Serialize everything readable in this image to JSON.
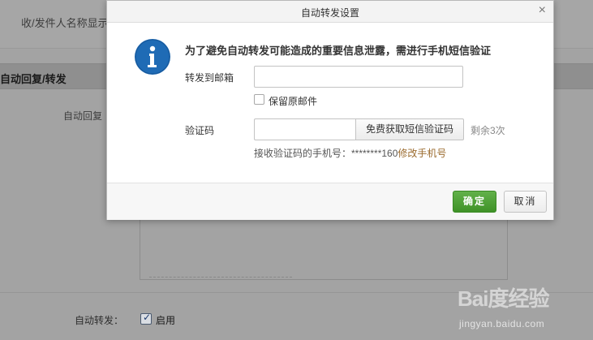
{
  "background": {
    "sender_name_label": "收/发件人名称显示",
    "section_title": "自动回复/转发",
    "auto_reply_label": "自动回复",
    "auto_forward_label": "自动转发：",
    "auto_forward_checkbox_label": "启用",
    "auto_forward_checked": true
  },
  "dialog": {
    "title": "自动转发设置",
    "close_glyph": "×",
    "warning": "为了避免自动转发可能造成的重要信息泄露，需进行手机短信验证",
    "forward_email_label": "转发到邮箱",
    "forward_email_value": "",
    "keep_original_label": "保留原邮件",
    "keep_original_checked": false,
    "code_label": "验证码",
    "code_value": "",
    "get_code_button": "免费获取短信验证码",
    "remaining": "剩余3次",
    "phone_prefix": "接收验证码的手机号：********160",
    "change_phone_link": "修改手机号",
    "ok_button": "确定",
    "cancel_button": "取消"
  },
  "watermark": {
    "brand": "Bai度经验",
    "url": "jingyan.baidu.com"
  },
  "colors": {
    "info_icon": "#1f6bb5",
    "ok_button": "#4fa236",
    "link": "#9b6b2e"
  },
  "icons": {
    "info": "info-icon",
    "close": "close-icon",
    "checkbox": "checkbox-icon"
  }
}
